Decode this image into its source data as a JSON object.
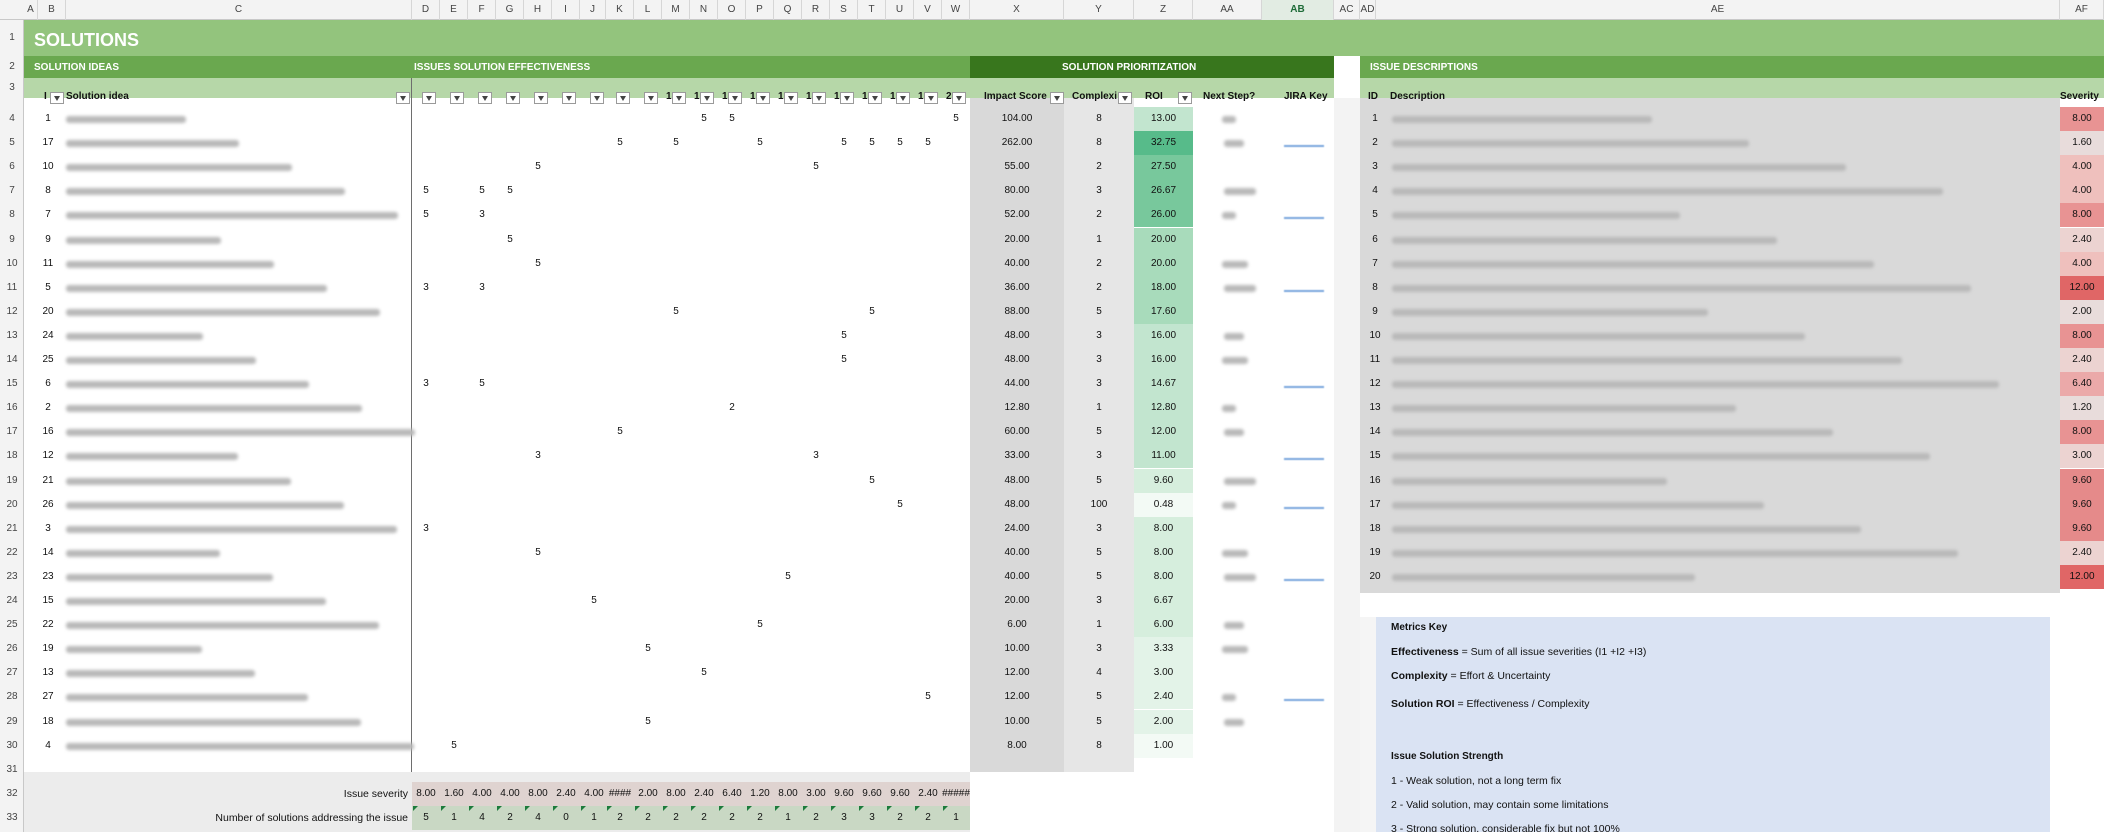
{
  "columns": [
    "A",
    "B",
    "C",
    "D",
    "E",
    "F",
    "G",
    "H",
    "I",
    "J",
    "K",
    "L",
    "M",
    "N",
    "O",
    "P",
    "Q",
    "R",
    "S",
    "T",
    "U",
    "V",
    "W",
    "X",
    "Y",
    "Z",
    "AA",
    "AB",
    "AC",
    "AD",
    "AE",
    "AF"
  ],
  "selected_column": "AB",
  "row_numbers": [
    1,
    2,
    3,
    4,
    5,
    6,
    7,
    8,
    9,
    10,
    11,
    12,
    13,
    14,
    15,
    16,
    17,
    18,
    19,
    20,
    21,
    22,
    23,
    24,
    25,
    26,
    27,
    28,
    29,
    30,
    31,
    32,
    33
  ],
  "title": "SOLUTIONS",
  "sections": {
    "ideas": "SOLUTION IDEAS",
    "effectiveness": "ISSUES SOLUTION EFFECTIVENESS",
    "prioritization": "SOLUTION PRIORITIZATION",
    "descriptions": "ISSUE DESCRIPTIONS"
  },
  "headers": {
    "id": "I",
    "idea": "Solution idea",
    "impact": "Impact Score",
    "complexity": "Complexi",
    "roi": "ROI",
    "next": "Next Step?",
    "jira": "JIRA Key",
    "desc_id": "ID",
    "desc": "Description",
    "severity": "Severity"
  },
  "issue_headers": [
    "",
    "",
    "",
    "",
    "",
    "",
    "",
    "",
    "",
    "1",
    "1",
    "1",
    "1",
    "1",
    "1",
    "1",
    "1",
    "1",
    "1",
    "2"
  ],
  "solutions": [
    {
      "id": "1",
      "issues": {
        "10": "5",
        "11": "5",
        "19": "5"
      },
      "impact": "104.00",
      "complexity": "8",
      "roi": "13.00"
    },
    {
      "id": "17",
      "issues": {
        "7": "5",
        "9": "5",
        "12": "5",
        "15": "5",
        "16": "5",
        "17": "5",
        "18": "5"
      },
      "impact": "262.00",
      "complexity": "8",
      "roi": "32.75"
    },
    {
      "id": "10",
      "issues": {
        "4": "5",
        "14": "5"
      },
      "impact": "55.00",
      "complexity": "2",
      "roi": "27.50"
    },
    {
      "id": "8",
      "issues": {
        "0": "5",
        "2": "5",
        "3": "5"
      },
      "impact": "80.00",
      "complexity": "3",
      "roi": "26.67"
    },
    {
      "id": "7",
      "issues": {
        "0": "5",
        "2": "3"
      },
      "impact": "52.00",
      "complexity": "2",
      "roi": "26.00"
    },
    {
      "id": "9",
      "issues": {
        "3": "5"
      },
      "impact": "20.00",
      "complexity": "1",
      "roi": "20.00"
    },
    {
      "id": "11",
      "issues": {
        "4": "5"
      },
      "impact": "40.00",
      "complexity": "2",
      "roi": "20.00"
    },
    {
      "id": "5",
      "issues": {
        "0": "3",
        "2": "3"
      },
      "impact": "36.00",
      "complexity": "2",
      "roi": "18.00"
    },
    {
      "id": "20",
      "issues": {
        "9": "5",
        "16": "5"
      },
      "impact": "88.00",
      "complexity": "5",
      "roi": "17.60"
    },
    {
      "id": "24",
      "issues": {
        "15": "5"
      },
      "impact": "48.00",
      "complexity": "3",
      "roi": "16.00"
    },
    {
      "id": "25",
      "issues": {
        "15": "5"
      },
      "impact": "48.00",
      "complexity": "3",
      "roi": "16.00"
    },
    {
      "id": "6",
      "issues": {
        "0": "3",
        "2": "5"
      },
      "impact": "44.00",
      "complexity": "3",
      "roi": "14.67"
    },
    {
      "id": "2",
      "issues": {
        "11": "2"
      },
      "impact": "12.80",
      "complexity": "1",
      "roi": "12.80"
    },
    {
      "id": "16",
      "issues": {
        "7": "5"
      },
      "impact": "60.00",
      "complexity": "5",
      "roi": "12.00"
    },
    {
      "id": "12",
      "issues": {
        "4": "3",
        "14": "3"
      },
      "impact": "33.00",
      "complexity": "3",
      "roi": "11.00"
    },
    {
      "id": "21",
      "issues": {
        "16": "5"
      },
      "impact": "48.00",
      "complexity": "5",
      "roi": "9.60"
    },
    {
      "id": "26",
      "issues": {
        "17": "5"
      },
      "impact": "48.00",
      "complexity": "100",
      "roi": "0.48"
    },
    {
      "id": "3",
      "issues": {
        "0": "3"
      },
      "impact": "24.00",
      "complexity": "3",
      "roi": "8.00"
    },
    {
      "id": "14",
      "issues": {
        "4": "5"
      },
      "impact": "40.00",
      "complexity": "5",
      "roi": "8.00"
    },
    {
      "id": "23",
      "issues": {
        "13": "5"
      },
      "impact": "40.00",
      "complexity": "5",
      "roi": "8.00"
    },
    {
      "id": "15",
      "issues": {
        "6": "5"
      },
      "impact": "20.00",
      "complexity": "3",
      "roi": "6.67"
    },
    {
      "id": "22",
      "issues": {
        "12": "5"
      },
      "impact": "6.00",
      "complexity": "1",
      "roi": "6.00"
    },
    {
      "id": "19",
      "issues": {
        "8": "5"
      },
      "impact": "10.00",
      "complexity": "3",
      "roi": "3.33"
    },
    {
      "id": "13",
      "issues": {
        "10": "5"
      },
      "impact": "12.00",
      "complexity": "4",
      "roi": "3.00"
    },
    {
      "id": "27",
      "issues": {
        "18": "5"
      },
      "impact": "12.00",
      "complexity": "5",
      "roi": "2.40"
    },
    {
      "id": "18",
      "issues": {
        "8": "5"
      },
      "impact": "10.00",
      "complexity": "5",
      "roi": "2.00"
    },
    {
      "id": "4",
      "issues": {
        "1": "5"
      },
      "impact": "8.00",
      "complexity": "8",
      "roi": "1.00"
    }
  ],
  "issue_severity_label": "Issue severity",
  "issue_severity": [
    "8.00",
    "1.60",
    "4.00",
    "4.00",
    "8.00",
    "2.40",
    "4.00",
    "####",
    "2.00",
    "8.00",
    "2.40",
    "6.40",
    "1.20",
    "8.00",
    "3.00",
    "9.60",
    "9.60",
    "9.60",
    "2.40",
    "#####"
  ],
  "solutions_count_label": "Number of solutions addressing the issue",
  "solutions_count": [
    "5",
    "1",
    "4",
    "2",
    "4",
    "0",
    "1",
    "2",
    "2",
    "2",
    "2",
    "2",
    "2",
    "1",
    "2",
    "3",
    "3",
    "2",
    "2",
    "1"
  ],
  "issues": [
    {
      "id": "1",
      "severity": "8.00"
    },
    {
      "id": "2",
      "severity": "1.60"
    },
    {
      "id": "3",
      "severity": "4.00"
    },
    {
      "id": "4",
      "severity": "4.00"
    },
    {
      "id": "5",
      "severity": "8.00"
    },
    {
      "id": "6",
      "severity": "2.40"
    },
    {
      "id": "7",
      "severity": "4.00"
    },
    {
      "id": "8",
      "severity": "12.00"
    },
    {
      "id": "9",
      "severity": "2.00"
    },
    {
      "id": "10",
      "severity": "8.00"
    },
    {
      "id": "11",
      "severity": "2.40"
    },
    {
      "id": "12",
      "severity": "6.40"
    },
    {
      "id": "13",
      "severity": "1.20"
    },
    {
      "id": "14",
      "severity": "8.00"
    },
    {
      "id": "15",
      "severity": "3.00"
    },
    {
      "id": "16",
      "severity": "9.60"
    },
    {
      "id": "17",
      "severity": "9.60"
    },
    {
      "id": "18",
      "severity": "9.60"
    },
    {
      "id": "19",
      "severity": "2.40"
    },
    {
      "id": "20",
      "severity": "12.00"
    }
  ],
  "metrics_key": {
    "title": "Metrics Key",
    "effectiveness_label": "Effectiveness",
    "effectiveness_text": " = Sum of all issue severities (I1 +I2 +I3)",
    "complexity_label": "Complexity",
    "complexity_text": " = Effort & Uncertainty",
    "roi_label": "Solution ROI",
    "roi_text": " = Effectiveness / Complexity"
  },
  "strength_key": {
    "title": "Issue Solution Strength",
    "items": [
      "1 - Weak solution, not a long term fix",
      "2 - Valid solution, may contain some limitations",
      "3 - Strong solution, considerable fix but not 100%"
    ]
  },
  "colors": {
    "title_bg": "#93c47d",
    "section_bg": "#6aa84f",
    "header_bg": "#b6d7a8",
    "prio_bg": "#38761d",
    "gray_bg": "#d9d9d9",
    "key_bg": "#dae3f3"
  }
}
